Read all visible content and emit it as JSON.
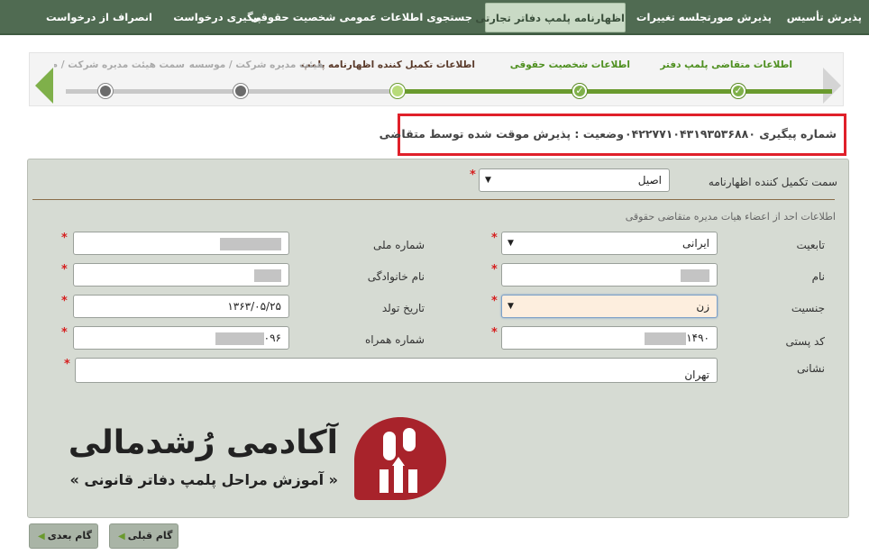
{
  "nav": {
    "items": [
      {
        "label": "پذیرش تأسیس"
      },
      {
        "label": "پذیرش صورتجلسه تغییرات"
      },
      {
        "label": "اظهارنامه پلمپ دفاتر تجارتی"
      },
      {
        "label": "جستجوی اطلاعات عمومی شخصیت حقوقی"
      },
      {
        "label": "پیگیری درخواست"
      },
      {
        "label": "انصراف از درخواست"
      }
    ]
  },
  "wizard": {
    "steps": [
      {
        "label": "اطلاعات متقاضی پلمپ دفتر",
        "state": "done"
      },
      {
        "label": "اطلاعات شخصیت حقوقی",
        "state": "done"
      },
      {
        "label": "اطلاعات تکمیل کننده اظهارنامه پلمپ",
        "state": "current"
      },
      {
        "label": "هیئت مدیره شرکت / موسسه",
        "state": "todo"
      },
      {
        "label": "سمت هیئت مدیره شرکت / م",
        "state": "todo"
      }
    ],
    "check_glyph": "✓"
  },
  "status": {
    "tracking": "شماره پیگیری ۰۴۲۲۷۷۱۰۴۳۱۹۳۵۳۶۸۸۰",
    "state": "وضعیت : پذیرش موقت شده توسط متقاضی"
  },
  "form": {
    "role_label": "سمت تکمیل کننده اظهارنامه",
    "role_value": "اصیل",
    "section_title": "اطلاعات احد از اعضاء هیات مدیره متقاضی حقوقی",
    "nationality_label": "تابعیت",
    "nationality_value": "ایرانی",
    "national_id_label": "شماره ملی",
    "name_label": "نام",
    "family_label": "نام خانوادگی",
    "gender_label": "جنسیت",
    "gender_value": "زن",
    "birth_label": "تاریخ تولد",
    "birth_value": "۱۳۶۳/۰۵/۲۵",
    "postal_label": "کد پستی",
    "postal_value": "۱۴۹۰",
    "mobile_label": "شماره همراه",
    "mobile_value": "۰۹۶",
    "address_label": "نشانی",
    "address_value": "تهران",
    "required_mark": "*",
    "dropdown_glyph": "▼"
  },
  "logo": {
    "title": "آکادمی رُشدمالی",
    "subtitle": "« آموزش مراحل پلمپ دفاتر قانونی »"
  },
  "buttons": {
    "prev": "گام قبلی",
    "next": "گام بعدی",
    "arrow_glyph": "◀"
  },
  "colors": {
    "nav_bg": "#506b52",
    "accent_green": "#6a9a2e",
    "highlight_red": "#e0202a",
    "logo_red": "#a8232b"
  }
}
